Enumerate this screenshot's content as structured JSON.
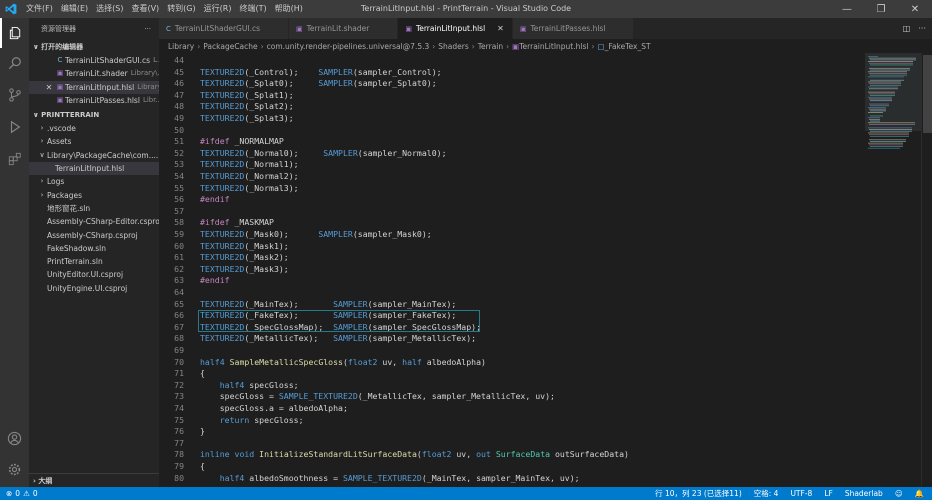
{
  "titlebar": {
    "title": "TerrainLitInput.hlsl - PrintTerrain - Visual Studio Code",
    "menu": [
      "文件(F)",
      "编辑(E)",
      "选择(S)",
      "查看(V)",
      "转到(G)",
      "运行(R)",
      "终端(T)",
      "帮助(H)"
    ]
  },
  "sidebar": {
    "title": "资源管理器",
    "open_editors_label": "打开的编辑器",
    "open_editors": [
      {
        "name": "TerrainLitShaderGUI.cs",
        "path": "L...",
        "icon_color": "#6fb3d2"
      },
      {
        "name": "TerrainLit.shader",
        "path": "Library\\...",
        "icon_color": "#a074c4"
      },
      {
        "name": "TerrainLitInput.hlsl",
        "path": "Library...",
        "icon_color": "#a074c4"
      },
      {
        "name": "TerrainLitPasses.hlsl",
        "path": "Libr...",
        "icon_color": "#a074c4"
      }
    ],
    "project_label": "PRINTTERRAIN",
    "tree": [
      {
        "name": ".vscode",
        "type": "folder",
        "indent": 0
      },
      {
        "name": "Assets",
        "type": "folder",
        "indent": 0
      },
      {
        "name": "Library\\PackageCache\\com....",
        "type": "folder-open",
        "indent": 0
      },
      {
        "name": "TerrainLitInput.hlsl",
        "type": "file",
        "indent": 1
      },
      {
        "name": "Logs",
        "type": "folder",
        "indent": 0
      },
      {
        "name": "Packages",
        "type": "folder",
        "indent": 0
      },
      {
        "name": "地形窗花.sln",
        "type": "file",
        "indent": 0
      },
      {
        "name": "Assembly-CSharp-Editor.csproj",
        "type": "file",
        "indent": 0
      },
      {
        "name": "Assembly-CSharp.csproj",
        "type": "file",
        "indent": 0
      },
      {
        "name": "FakeShadow.sln",
        "type": "file",
        "indent": 0
      },
      {
        "name": "PrintTerrain.sln",
        "type": "file",
        "indent": 0
      },
      {
        "name": "UnityEditor.UI.csproj",
        "type": "file",
        "indent": 0
      },
      {
        "name": "UnityEngine.UI.csproj",
        "type": "file",
        "indent": 0
      }
    ],
    "outline_label": "大纲"
  },
  "tabs": [
    {
      "label": "TerrainLitShaderGUI.cs",
      "active": false
    },
    {
      "label": "TerrainLit.shader",
      "active": false
    },
    {
      "label": "TerrainLitInput.hlsl",
      "active": true
    },
    {
      "label": "TerrainLitPasses.hlsl",
      "active": false
    }
  ],
  "breadcrumb": [
    "Library",
    "PackageCache",
    "com.unity.render-pipelines.universal@7.5.3",
    "Shaders",
    "Terrain",
    "TerrainLitInput.hlsl",
    "_FakeTex_ST"
  ],
  "editor": {
    "lines": [
      {
        "n": "44",
        "code": ""
      },
      {
        "n": "45",
        "code": "TEXTURE2D(_Control);    SAMPLER(sampler_Control);"
      },
      {
        "n": "46",
        "code": "TEXTURE2D(_Splat0);     SAMPLER(sampler_Splat0);"
      },
      {
        "n": "47",
        "code": "TEXTURE2D(_Splat1);"
      },
      {
        "n": "48",
        "code": "TEXTURE2D(_Splat2);"
      },
      {
        "n": "49",
        "code": "TEXTURE2D(_Splat3);"
      },
      {
        "n": "50",
        "code": ""
      },
      {
        "n": "51",
        "code": "#ifdef _NORMALMAP"
      },
      {
        "n": "52",
        "code": "TEXTURE2D(_Normal0);     SAMPLER(sampler_Normal0);"
      },
      {
        "n": "53",
        "code": "TEXTURE2D(_Normal1);"
      },
      {
        "n": "54",
        "code": "TEXTURE2D(_Normal2);"
      },
      {
        "n": "55",
        "code": "TEXTURE2D(_Normal3);"
      },
      {
        "n": "56",
        "code": "#endif"
      },
      {
        "n": "57",
        "code": ""
      },
      {
        "n": "58",
        "code": "#ifdef _MASKMAP"
      },
      {
        "n": "59",
        "code": "TEXTURE2D(_Mask0);      SAMPLER(sampler_Mask0);"
      },
      {
        "n": "60",
        "code": "TEXTURE2D(_Mask1);"
      },
      {
        "n": "61",
        "code": "TEXTURE2D(_Mask2);"
      },
      {
        "n": "62",
        "code": "TEXTURE2D(_Mask3);"
      },
      {
        "n": "63",
        "code": "#endif"
      },
      {
        "n": "64",
        "code": ""
      },
      {
        "n": "65",
        "code": "TEXTURE2D(_MainTex);       SAMPLER(sampler_MainTex);"
      },
      {
        "n": "66",
        "code": "TEXTURE2D(_FakeTex);       SAMPLER(sampler_FakeTex);"
      },
      {
        "n": "67",
        "code": "TEXTURE2D(_SpecGlossMap);  SAMPLER(sampler_SpecGlossMap);"
      },
      {
        "n": "68",
        "code": "TEXTURE2D(_MetallicTex);   SAMPLER(sampler_MetallicTex);"
      },
      {
        "n": "69",
        "code": ""
      },
      {
        "n": "70",
        "code": "half4 SampleMetallicSpecGloss(float2 uv, half albedoAlpha)"
      },
      {
        "n": "71",
        "code": "{"
      },
      {
        "n": "72",
        "code": "    half4 specGloss;"
      },
      {
        "n": "73",
        "code": "    specGloss = SAMPLE_TEXTURE2D(_MetallicTex, sampler_MetallicTex, uv);"
      },
      {
        "n": "74",
        "code": "    specGloss.a = albedoAlpha;"
      },
      {
        "n": "75",
        "code": "    return specGloss;"
      },
      {
        "n": "76",
        "code": "}"
      },
      {
        "n": "77",
        "code": ""
      },
      {
        "n": "78",
        "code": "inline void InitializeStandardLitSurfaceData(float2 uv, out SurfaceData outSurfaceData)"
      },
      {
        "n": "79",
        "code": "{"
      },
      {
        "n": "80",
        "code": "    half4 albedoSmoothness = SAMPLE_TEXTURE2D(_MainTex, sampler_MainTex, uv);"
      }
    ]
  },
  "statusbar": {
    "errors": "0",
    "warnings": "0",
    "cursor": "行 10，列 23 (已选择11)",
    "spaces": "空格: 4",
    "encoding": "UTF-8",
    "eol": "LF",
    "language": "Shaderlab"
  },
  "colors": {
    "accent": "#007acc",
    "editor_bg": "#1e1e1e",
    "sidebar_bg": "#252526"
  }
}
